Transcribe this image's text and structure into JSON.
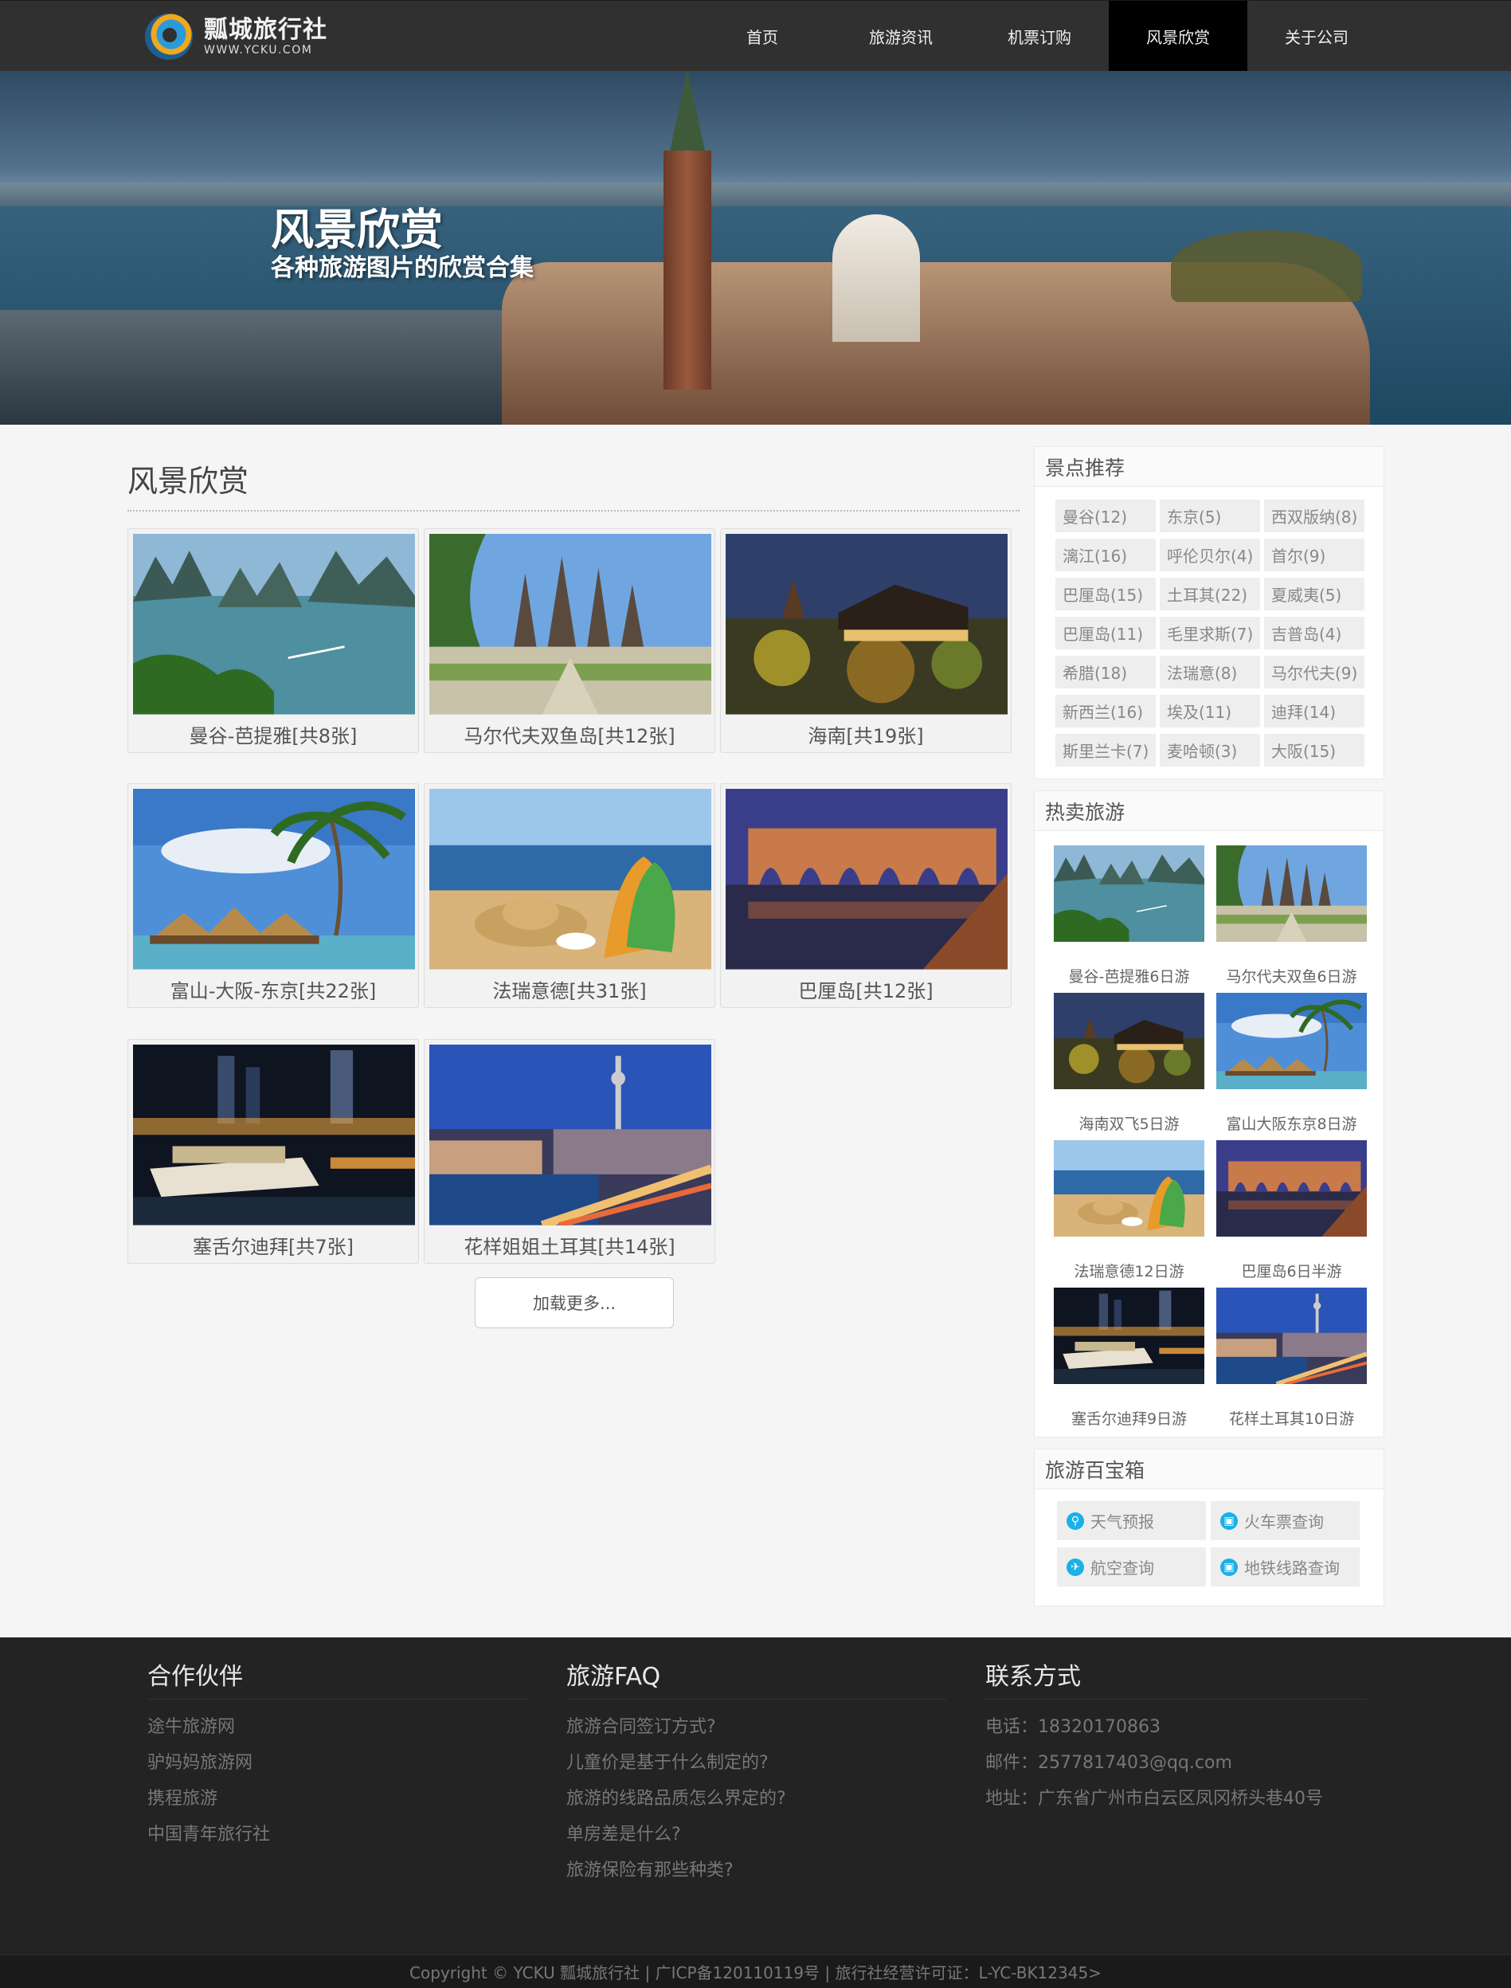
{
  "header": {
    "logo_cn": "瓢城旅行社",
    "logo_en": "WWW.YCKU.COM",
    "nav": [
      {
        "label": "首页",
        "active": false
      },
      {
        "label": "旅游资讯",
        "active": false
      },
      {
        "label": "机票订购",
        "active": false
      },
      {
        "label": "风景欣赏",
        "active": true
      },
      {
        "label": "关于公司",
        "active": false
      }
    ]
  },
  "banner": {
    "title": "风景欣赏",
    "subtitle": "各种旅游图片的欣赏合集"
  },
  "main": {
    "title": "风景欣赏",
    "albums": [
      {
        "caption": "曼谷-芭提雅[共8张]",
        "scene": "bay"
      },
      {
        "caption": "马尔代夫双鱼岛[共12张]",
        "scene": "temple"
      },
      {
        "caption": "海南[共19张]",
        "scene": "night-temple"
      },
      {
        "caption": "富山-大阪-东京[共22张]",
        "scene": "palm-hut"
      },
      {
        "caption": "法瑞意德[共31张]",
        "scene": "beach"
      },
      {
        "caption": "巴厘岛[共12张]",
        "scene": "aqueduct"
      },
      {
        "caption": "塞舌尔迪拜[共7张]",
        "scene": "harbor-night"
      },
      {
        "caption": "花样姐姐土耳其[共14张]",
        "scene": "city-dusk"
      }
    ],
    "load_more": "加载更多..."
  },
  "sidebar": {
    "spots_title": "景点推荐",
    "spots": [
      "曼谷(12)",
      "东京(5)",
      "西双版纳(8)",
      "漓江(16)",
      "呼伦贝尔(4)",
      "首尔(9)",
      "巴厘岛(15)",
      "土耳其(22)",
      "夏威夷(5)",
      "巴厘岛(11)",
      "毛里求斯(7)",
      "吉普岛(4)",
      "希腊(18)",
      "法瑞意(8)",
      "马尔代夫(9)",
      "新西兰(16)",
      "埃及(11)",
      "迪拜(14)",
      "斯里兰卡(7)",
      "麦哈顿(3)",
      "大阪(15)"
    ],
    "hot_title": "热卖旅游",
    "hot": [
      {
        "caption": "曼谷-芭提雅6日游",
        "scene": "bay"
      },
      {
        "caption": "马尔代夫双鱼6日游",
        "scene": "temple"
      },
      {
        "caption": "海南双飞5日游",
        "scene": "night-temple"
      },
      {
        "caption": "富山大阪东京8日游",
        "scene": "palm-hut"
      },
      {
        "caption": "法瑞意德12日游",
        "scene": "beach"
      },
      {
        "caption": "巴厘岛6日半游",
        "scene": "aqueduct"
      },
      {
        "caption": "塞舌尔迪拜9日游",
        "scene": "harbor-night"
      },
      {
        "caption": "花样土耳其10日游",
        "scene": "city-dusk"
      }
    ],
    "tools_title": "旅游百宝箱",
    "tools": [
      {
        "label": "天气预报",
        "icon": "location-pin-icon",
        "glyph": "⚲"
      },
      {
        "label": "火车票查询",
        "icon": "train-icon",
        "glyph": "▣"
      },
      {
        "label": "航空查询",
        "icon": "plane-icon",
        "glyph": "✈"
      },
      {
        "label": "地铁线路查询",
        "icon": "subway-icon",
        "glyph": "▣"
      }
    ]
  },
  "footer": {
    "partners": {
      "title": "合作伙伴",
      "links": [
        "途牛旅游网",
        "驴妈妈旅游网",
        "携程旅游",
        "中国青年旅行社"
      ]
    },
    "faq": {
      "title": "旅游FAQ",
      "links": [
        "旅游合同签订方式?",
        "儿童价是基于什么制定的?",
        "旅游的线路品质怎么界定的?",
        "单房差是什么?",
        "旅游保险有那些种类?"
      ]
    },
    "contact": {
      "title": "联系方式",
      "lines": [
        "电话：18320170863",
        "邮件：2577817403@qq.com",
        "地址：广东省广州市白云区凤冈桥头巷40号"
      ]
    },
    "copyright": "Copyright © YCKU 瓢城旅行社 | 广ICP备120110119号 | 旅行社经营许可证：L-YC-BK12345>"
  },
  "colors": {
    "header_bg": "#303030",
    "nav_active_bg": "#000000",
    "footer_bg": "#232323",
    "tool_icon": "#1ab0e8"
  }
}
